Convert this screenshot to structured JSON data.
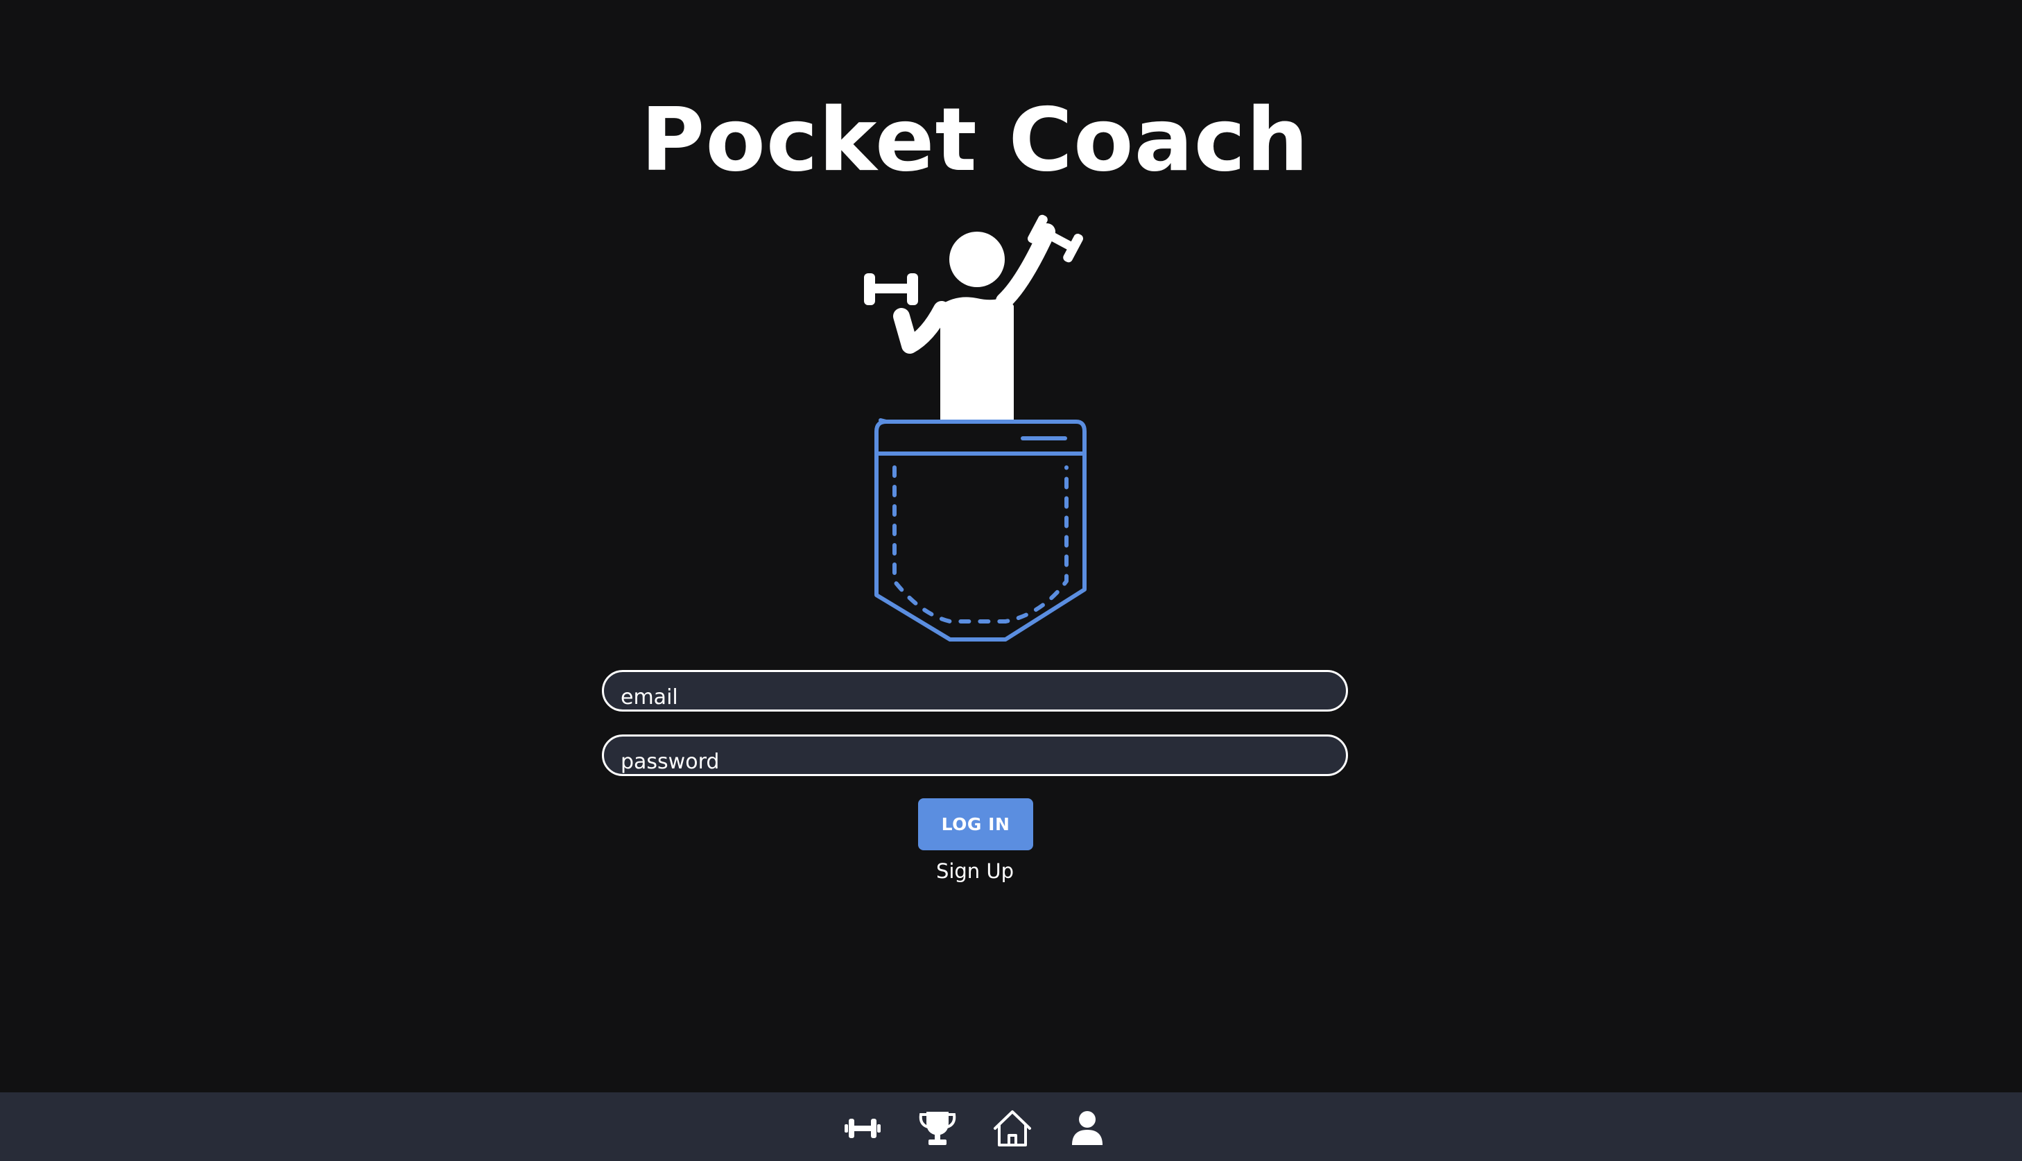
{
  "app": {
    "title": "Pocket Coach"
  },
  "login_form": {
    "email_placeholder": "email",
    "password_placeholder": "password",
    "login_label": "LOG IN",
    "signup_label": "Sign Up"
  },
  "bottom_nav": {
    "items": [
      {
        "icon": "dumbbell-icon"
      },
      {
        "icon": "trophy-icon"
      },
      {
        "icon": "home-icon"
      },
      {
        "icon": "user-icon"
      }
    ]
  },
  "colors": {
    "background": "#111112",
    "surface": "#282c38",
    "accent": "#5b8ee0",
    "text": "#ffffff"
  }
}
